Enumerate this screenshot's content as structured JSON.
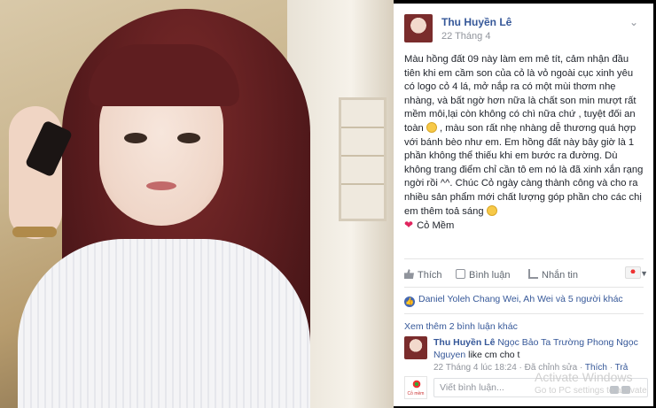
{
  "post": {
    "author": "Thu Huyền Lê",
    "time": "22 Tháng 4",
    "body": "Màu hồng đất 09 này làm em mê tít, cảm nhận đầu tiên khi em cầm son của cỏ là vỏ ngoài cục xinh yêu có logo cỏ 4 lá, mở nắp ra có một mùi thơm nhẹ nhàng, và bất ngờ hơn nữa là chất son min mượt rất mềm môi,lại còn không có chì nữa chứ , tuyệt đối an toàn",
    "body_2": ", màu son rất nhẹ nhàng dễ thương quá hợp với bánh bèo như em. Em hồng đất này bây giờ là 1 phần không thể thiếu khi em bước ra đường. Dù không trang điểm chỉ cần tô em nó là đã xinh xắn rạng ngời rồi ^^. Chúc Cỏ ngày càng thành công và cho ra nhiều sản phẩm mới chất lượng góp phần cho các chị em thêm toả sáng",
    "signature": "Cỏ Mềm"
  },
  "actions": {
    "like": "Thích",
    "comment": "Bình luận",
    "share": "Nhắn tin"
  },
  "likes_summary": "Daniel Yoleh Chang Wei, Ah Wei và 5 người khác",
  "more_comments": "Xem thêm 2 bình luận khác",
  "comment": {
    "author": "Thu Huyền Lê",
    "tag": "Ngọc Bảo Ta Trường Phong Ngọc Nguyen",
    "text": "like cm cho t",
    "time": "22 Tháng 4 lúc 18:24",
    "edited": "Đã chỉnh sửa",
    "like": "Thích",
    "reply": "Trả"
  },
  "reply_box": {
    "placeholder": "Viết bình luận...",
    "logo_text": "Cỏ mềm"
  },
  "watermark": {
    "line1": "Activate Windows",
    "line2": "Go to PC settings to activate"
  },
  "colors": {
    "link": "#365899",
    "like_badge": "#4267b2",
    "heart": "#e0245e"
  }
}
